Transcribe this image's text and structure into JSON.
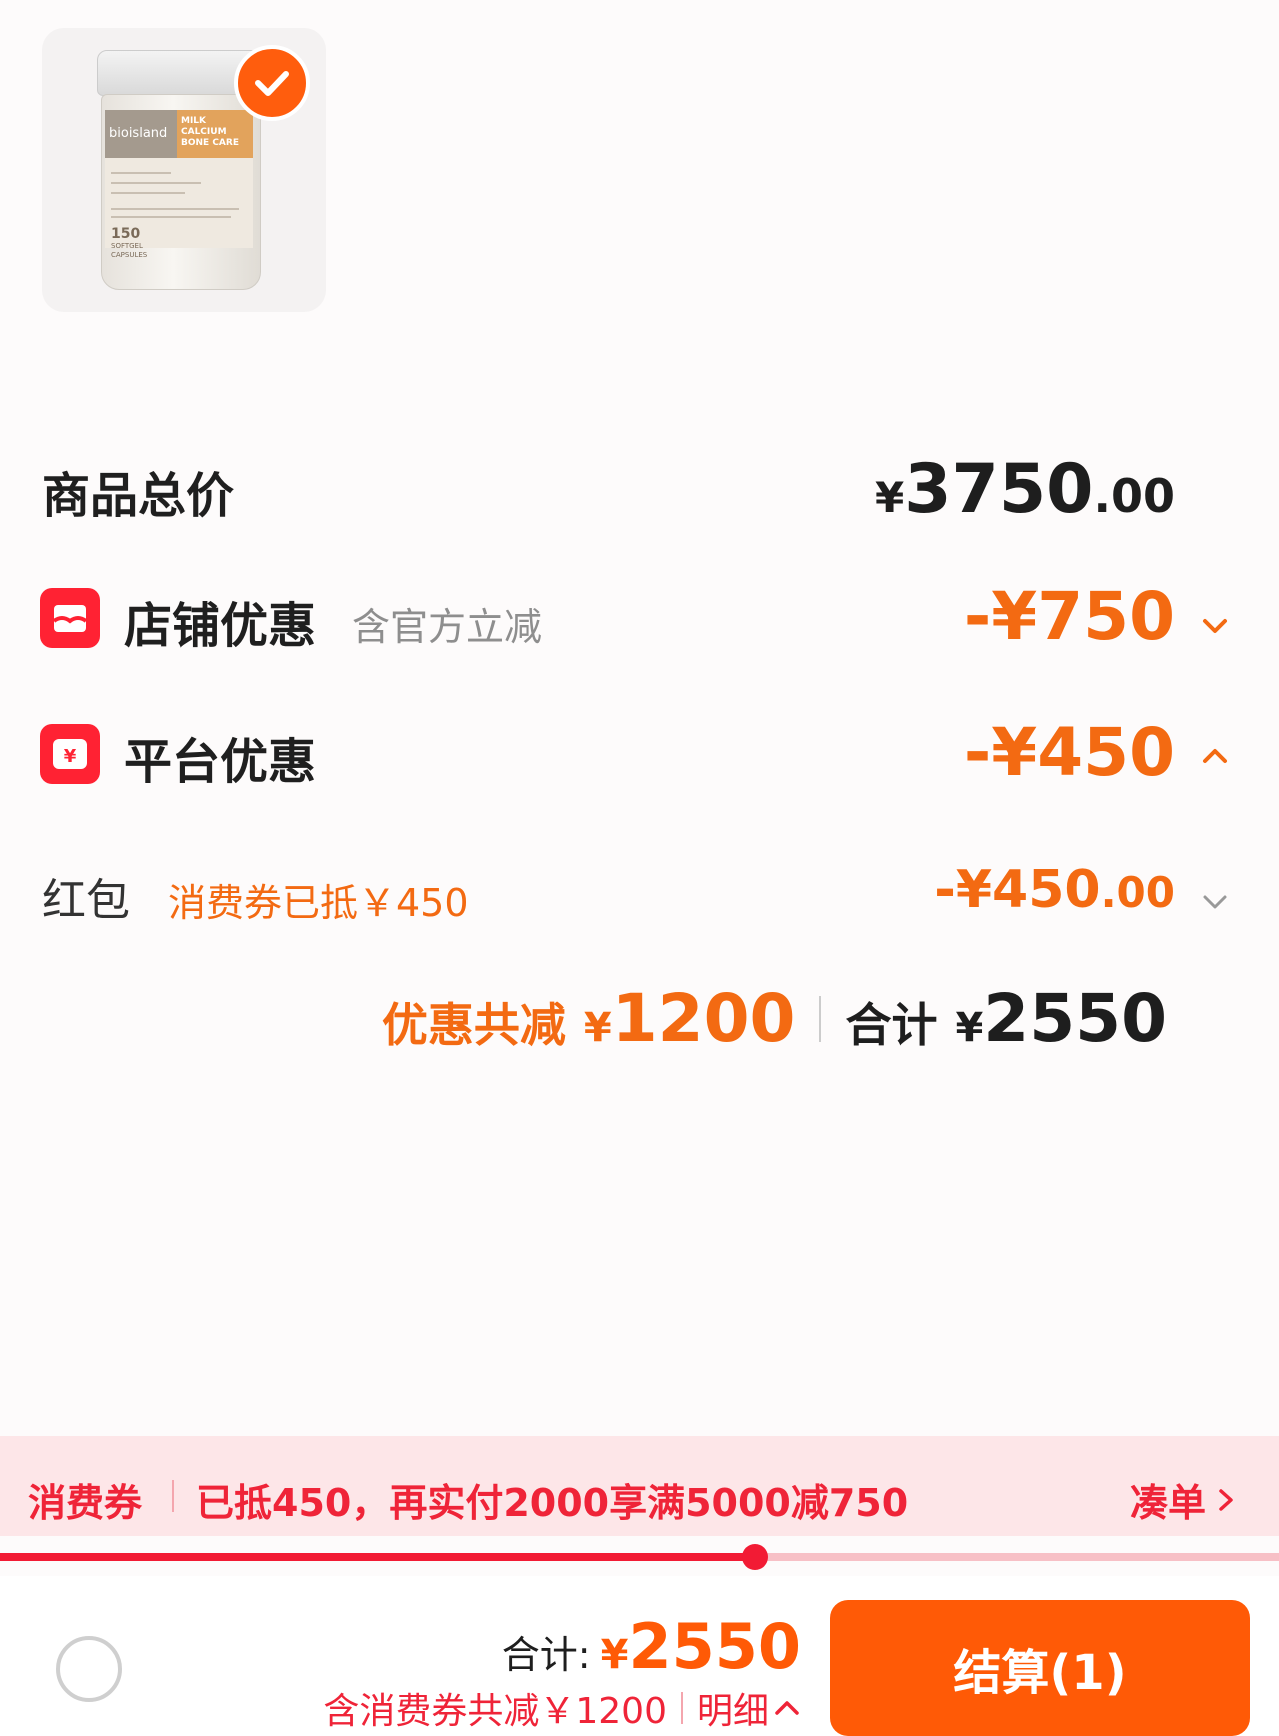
{
  "product": {
    "brand": "bioisland",
    "name": "MILK CALCIUM BONE CARE",
    "count": "150",
    "count_unit": "SOFTGEL CAPSULES",
    "selected": true
  },
  "summary": {
    "total_label": "商品总价",
    "total_currency": "¥",
    "total_int": "3750",
    "total_dec": ".00",
    "shop_label": "店铺优惠",
    "shop_note": "含官方立减",
    "shop_amount": "-¥750",
    "platform_label": "平台优惠",
    "platform_amount": "-¥450",
    "redpacket_label": "红包",
    "redpacket_note": "消费券已抵￥450",
    "redpacket_amount_int": "-¥450",
    "redpacket_amount_dec": ".00",
    "discount_label": "优惠共减",
    "discount_currency": "¥",
    "discount_value": "1200",
    "subtotal_label": "合计",
    "subtotal_currency": "¥",
    "subtotal_value": "2550"
  },
  "coupon": {
    "title": "消费券",
    "text": "已抵450，再实付2000享满5000减750",
    "action": "凑单",
    "progress_fraction": 0.59
  },
  "bottom": {
    "total_label": "合计:",
    "total_currency": "¥",
    "total_value": "2550",
    "note": "含消费券共减￥1200",
    "detail_label": "明细",
    "checkout_label": "结算(1)"
  },
  "colors": {
    "accent_orange": "#ff5a06",
    "discount_orange": "#f36a12",
    "coupon_red": "#ef2438",
    "icon_red": "#ff2233"
  },
  "icons": {
    "selected": "check-icon",
    "shop": "store-icon",
    "platform": "yuan-coupon-icon",
    "chevron_down": "chevron-down-icon",
    "chevron_up": "chevron-up-icon",
    "chevron_right": "chevron-right-icon"
  }
}
